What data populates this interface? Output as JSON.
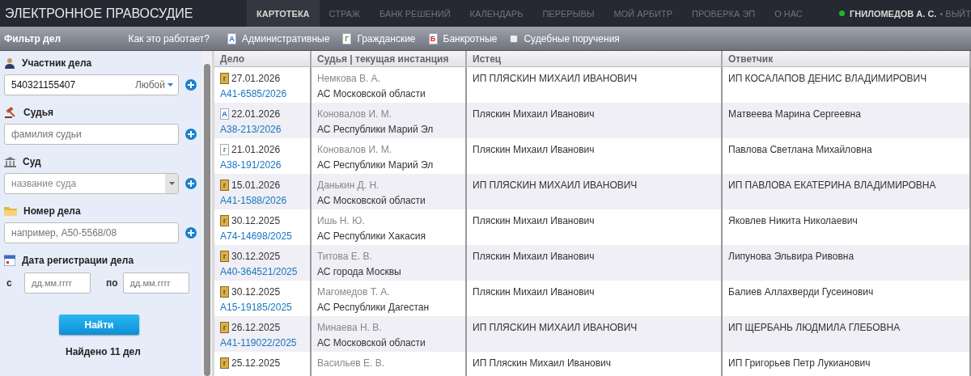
{
  "header": {
    "title": "ЭЛЕКТРОННОЕ ПРАВОСУДИЕ",
    "nav": [
      {
        "label": "КАРТОТЕКА",
        "selected": true
      },
      {
        "label": "СТРАЖ",
        "selected": false
      },
      {
        "label": "БАНК РЕШЕНИЙ",
        "selected": false
      },
      {
        "label": "КАЛЕНДАРЬ",
        "selected": false
      },
      {
        "label": "ПЕРЕРЫВЫ",
        "selected": false
      },
      {
        "label": "МОЙ АРБИТР",
        "selected": false
      },
      {
        "label": "ПРОВЕРКА ЭП",
        "selected": false
      },
      {
        "label": "О НАС",
        "selected": false
      }
    ],
    "user": {
      "name": "ГНИЛОМЕДОВ А. С.",
      "online": true,
      "logout": "• ВЫЙТ"
    }
  },
  "filter_bar": {
    "title": "Фильтр дел",
    "help": "Как это работает?",
    "types": [
      {
        "kind": "admin",
        "letter": "A",
        "label": "Административные"
      },
      {
        "kind": "civil",
        "letter": "Г",
        "label": "Гражданские"
      },
      {
        "kind": "bankrupt",
        "letter": "Б",
        "label": "Банкротные"
      },
      {
        "kind": "checkbox",
        "label": "Судебные поручения",
        "checked": false
      }
    ]
  },
  "sidebar": {
    "participant": {
      "label": "Участник дела",
      "value": "540321155407",
      "role": "Любой"
    },
    "judge": {
      "label": "Судья",
      "placeholder": "фамилия судьи"
    },
    "court": {
      "label": "Суд",
      "placeholder": "название суда"
    },
    "case_number": {
      "label": "Номер дела",
      "placeholder": "например, А50-5568/08"
    },
    "date": {
      "label": "Дата регистрации дела",
      "from_label": "с",
      "from_placeholder": "дд.мм.гггг",
      "to_label": "по",
      "to_placeholder": "дд.мм.гггг"
    },
    "search_button": "Найти",
    "found": "Найдено 11 дел"
  },
  "table": {
    "columns": [
      "Дело",
      "Судья | текущая инстанция",
      "Истец",
      "Ответчик"
    ],
    "rows": [
      {
        "kind": "folder",
        "letter": "г",
        "date": "27.01.2026",
        "number": "А41-6585/2026",
        "judge": "Немкова В. А.",
        "court": "АС Московской области",
        "plaintiff": "ИП ПЛЯСКИН МИХАИЛ ИВАНОВИЧ",
        "defendant": "ИП КОСАЛАПОВ ДЕНИС ВЛАДИМИРОВИЧ"
      },
      {
        "kind": "admin",
        "letter": "A",
        "date": "22.01.2026",
        "number": "А38-213/2026",
        "judge": "Коновалов И. М.",
        "court": "АС Республики Марий Эл",
        "plaintiff": "Пляскин Михаил Иванович",
        "defendant": "Матвеева Марина Сергеевна"
      },
      {
        "kind": "civil",
        "letter": "г",
        "date": "21.01.2026",
        "number": "А38-191/2026",
        "judge": "Коновалов И. М.",
        "court": "АС Республики Марий Эл",
        "plaintiff": "Пляскин Михаил Иванович",
        "defendant": "Павлова Светлана Михайловна"
      },
      {
        "kind": "folder",
        "letter": "г",
        "date": "15.01.2026",
        "number": "А41-1588/2026",
        "judge": "Данькин Д. Н.",
        "court": "АС Московской области",
        "plaintiff": "ИП ПЛЯСКИН МИХАИЛ ИВАНОВИЧ",
        "defendant": "ИП ПАВЛОВА ЕКАТЕРИНА ВЛАДИМИРОВНА"
      },
      {
        "kind": "folder",
        "letter": "г",
        "date": "30.12.2025",
        "number": "А74-14698/2025",
        "judge": "Ишь Н. Ю.",
        "court": "АС Республики Хакасия",
        "plaintiff": "Пляскин Михаил Иванович",
        "defendant": "Яковлев Никита Николаевич"
      },
      {
        "kind": "folder",
        "letter": "г",
        "date": "30.12.2025",
        "number": "А40-364521/2025",
        "judge": "Титова Е. В.",
        "court": "АС города Москвы",
        "plaintiff": "Пляскин Михаил Иванович",
        "defendant": "Липунова Эльвира Ривовна"
      },
      {
        "kind": "folder",
        "letter": "г",
        "date": "30.12.2025",
        "number": "А15-19185/2025",
        "judge": "Магомедов Т. А.",
        "court": "АС Республики Дагестан",
        "plaintiff": "Пляскин Михаил Иванович",
        "defendant": "Балиев Аллахверди Гусеинович"
      },
      {
        "kind": "folder",
        "letter": "г",
        "date": "26.12.2025",
        "number": "А41-119022/2025",
        "judge": "Минаева Н. В.",
        "court": "АС Московской области",
        "plaintiff": "ИП ПЛЯСКИН МИХАИЛ ИВАНОВИЧ",
        "defendant": "ИП ЩЕРБАНЬ ЛЮДМИЛА ГЛЕБОВНА"
      },
      {
        "kind": "folder",
        "letter": "г",
        "date": "25.12.2025",
        "judge": "Васильев Е. В.",
        "plaintiff": "ИП Пляскин Михаил Иванович",
        "defendant": "ИП Григорьев Петр Лукианович"
      }
    ]
  }
}
